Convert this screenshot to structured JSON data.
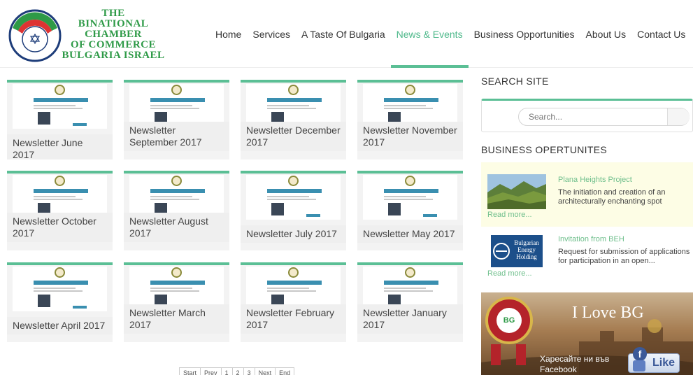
{
  "logo": {
    "lines": [
      "THE",
      "BINATIONAL",
      "CHAMBER",
      "OF COMMERCE",
      "BULGARIA ISRAEL"
    ]
  },
  "nav": {
    "items": [
      {
        "label": "Home"
      },
      {
        "label": "Services"
      },
      {
        "label": "A Taste Of Bulgaria"
      },
      {
        "label": "News & Events"
      },
      {
        "label": "Business Opportunities"
      },
      {
        "label": "About Us"
      },
      {
        "label": "Contact Us"
      }
    ],
    "active": "News & Events"
  },
  "newsletters": [
    {
      "title": "Newsletter June 2017"
    },
    {
      "title": "Newsletter September 2017"
    },
    {
      "title": "Newsletter December 2017"
    },
    {
      "title": "Newsletter November 2017"
    },
    {
      "title": "Newsletter October 2017"
    },
    {
      "title": "Newsletter August 2017"
    },
    {
      "title": "Newsletter July 2017"
    },
    {
      "title": "Newsletter May 2017"
    },
    {
      "title": "Newsletter April 2017"
    },
    {
      "title": "Newsletter March 2017"
    },
    {
      "title": "Newsletter February 2017"
    },
    {
      "title": "Newsletter January 2017"
    }
  ],
  "pagination": {
    "start": "Start",
    "prev": "Prev",
    "pages": [
      "1",
      "2",
      "3"
    ],
    "next": "Next",
    "end": "End"
  },
  "sidebar": {
    "search_heading": "SEARCH SITE",
    "search_placeholder": "Search...",
    "business_heading": "BUSINESS OPERTUNITES",
    "business_items": [
      {
        "title": "Plana Heights Project",
        "description": "The initiation and creation of an architecturally enchanting spot",
        "more": "Read more..."
      },
      {
        "title": "Invitation from BEH",
        "description": "Request for submission of applications for participation in an open...",
        "more": "Read more...",
        "logo_text": "Bulgarian Energy Holding"
      }
    ],
    "banner": {
      "title": "I Love BG",
      "badge": "BG",
      "facebook_text": "Харесайте ни във Facebook",
      "like_label": "Like"
    }
  },
  "colors": {
    "accent": "#5bbf95",
    "logo_green": "#2e9a47",
    "link_green": "#6fbf8c"
  }
}
